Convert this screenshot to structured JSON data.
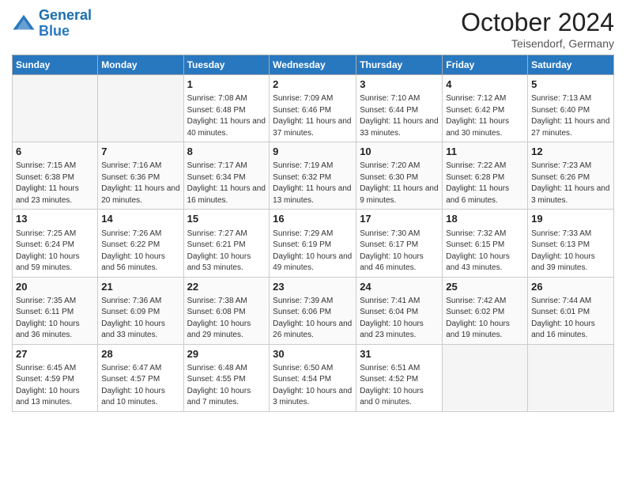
{
  "header": {
    "logo_general": "General",
    "logo_blue": "Blue",
    "month_title": "October 2024",
    "subtitle": "Teisendorf, Germany"
  },
  "days_of_week": [
    "Sunday",
    "Monday",
    "Tuesday",
    "Wednesday",
    "Thursday",
    "Friday",
    "Saturday"
  ],
  "weeks": [
    [
      {
        "day": "",
        "empty": true
      },
      {
        "day": "",
        "empty": true
      },
      {
        "day": "1",
        "sunrise": "Sunrise: 7:08 AM",
        "sunset": "Sunset: 6:48 PM",
        "daylight": "Daylight: 11 hours and 40 minutes."
      },
      {
        "day": "2",
        "sunrise": "Sunrise: 7:09 AM",
        "sunset": "Sunset: 6:46 PM",
        "daylight": "Daylight: 11 hours and 37 minutes."
      },
      {
        "day": "3",
        "sunrise": "Sunrise: 7:10 AM",
        "sunset": "Sunset: 6:44 PM",
        "daylight": "Daylight: 11 hours and 33 minutes."
      },
      {
        "day": "4",
        "sunrise": "Sunrise: 7:12 AM",
        "sunset": "Sunset: 6:42 PM",
        "daylight": "Daylight: 11 hours and 30 minutes."
      },
      {
        "day": "5",
        "sunrise": "Sunrise: 7:13 AM",
        "sunset": "Sunset: 6:40 PM",
        "daylight": "Daylight: 11 hours and 27 minutes."
      }
    ],
    [
      {
        "day": "6",
        "sunrise": "Sunrise: 7:15 AM",
        "sunset": "Sunset: 6:38 PM",
        "daylight": "Daylight: 11 hours and 23 minutes."
      },
      {
        "day": "7",
        "sunrise": "Sunrise: 7:16 AM",
        "sunset": "Sunset: 6:36 PM",
        "daylight": "Daylight: 11 hours and 20 minutes."
      },
      {
        "day": "8",
        "sunrise": "Sunrise: 7:17 AM",
        "sunset": "Sunset: 6:34 PM",
        "daylight": "Daylight: 11 hours and 16 minutes."
      },
      {
        "day": "9",
        "sunrise": "Sunrise: 7:19 AM",
        "sunset": "Sunset: 6:32 PM",
        "daylight": "Daylight: 11 hours and 13 minutes."
      },
      {
        "day": "10",
        "sunrise": "Sunrise: 7:20 AM",
        "sunset": "Sunset: 6:30 PM",
        "daylight": "Daylight: 11 hours and 9 minutes."
      },
      {
        "day": "11",
        "sunrise": "Sunrise: 7:22 AM",
        "sunset": "Sunset: 6:28 PM",
        "daylight": "Daylight: 11 hours and 6 minutes."
      },
      {
        "day": "12",
        "sunrise": "Sunrise: 7:23 AM",
        "sunset": "Sunset: 6:26 PM",
        "daylight": "Daylight: 11 hours and 3 minutes."
      }
    ],
    [
      {
        "day": "13",
        "sunrise": "Sunrise: 7:25 AM",
        "sunset": "Sunset: 6:24 PM",
        "daylight": "Daylight: 10 hours and 59 minutes."
      },
      {
        "day": "14",
        "sunrise": "Sunrise: 7:26 AM",
        "sunset": "Sunset: 6:22 PM",
        "daylight": "Daylight: 10 hours and 56 minutes."
      },
      {
        "day": "15",
        "sunrise": "Sunrise: 7:27 AM",
        "sunset": "Sunset: 6:21 PM",
        "daylight": "Daylight: 10 hours and 53 minutes."
      },
      {
        "day": "16",
        "sunrise": "Sunrise: 7:29 AM",
        "sunset": "Sunset: 6:19 PM",
        "daylight": "Daylight: 10 hours and 49 minutes."
      },
      {
        "day": "17",
        "sunrise": "Sunrise: 7:30 AM",
        "sunset": "Sunset: 6:17 PM",
        "daylight": "Daylight: 10 hours and 46 minutes."
      },
      {
        "day": "18",
        "sunrise": "Sunrise: 7:32 AM",
        "sunset": "Sunset: 6:15 PM",
        "daylight": "Daylight: 10 hours and 43 minutes."
      },
      {
        "day": "19",
        "sunrise": "Sunrise: 7:33 AM",
        "sunset": "Sunset: 6:13 PM",
        "daylight": "Daylight: 10 hours and 39 minutes."
      }
    ],
    [
      {
        "day": "20",
        "sunrise": "Sunrise: 7:35 AM",
        "sunset": "Sunset: 6:11 PM",
        "daylight": "Daylight: 10 hours and 36 minutes."
      },
      {
        "day": "21",
        "sunrise": "Sunrise: 7:36 AM",
        "sunset": "Sunset: 6:09 PM",
        "daylight": "Daylight: 10 hours and 33 minutes."
      },
      {
        "day": "22",
        "sunrise": "Sunrise: 7:38 AM",
        "sunset": "Sunset: 6:08 PM",
        "daylight": "Daylight: 10 hours and 29 minutes."
      },
      {
        "day": "23",
        "sunrise": "Sunrise: 7:39 AM",
        "sunset": "Sunset: 6:06 PM",
        "daylight": "Daylight: 10 hours and 26 minutes."
      },
      {
        "day": "24",
        "sunrise": "Sunrise: 7:41 AM",
        "sunset": "Sunset: 6:04 PM",
        "daylight": "Daylight: 10 hours and 23 minutes."
      },
      {
        "day": "25",
        "sunrise": "Sunrise: 7:42 AM",
        "sunset": "Sunset: 6:02 PM",
        "daylight": "Daylight: 10 hours and 19 minutes."
      },
      {
        "day": "26",
        "sunrise": "Sunrise: 7:44 AM",
        "sunset": "Sunset: 6:01 PM",
        "daylight": "Daylight: 10 hours and 16 minutes."
      }
    ],
    [
      {
        "day": "27",
        "sunrise": "Sunrise: 6:45 AM",
        "sunset": "Sunset: 4:59 PM",
        "daylight": "Daylight: 10 hours and 13 minutes."
      },
      {
        "day": "28",
        "sunrise": "Sunrise: 6:47 AM",
        "sunset": "Sunset: 4:57 PM",
        "daylight": "Daylight: 10 hours and 10 minutes."
      },
      {
        "day": "29",
        "sunrise": "Sunrise: 6:48 AM",
        "sunset": "Sunset: 4:55 PM",
        "daylight": "Daylight: 10 hours and 7 minutes."
      },
      {
        "day": "30",
        "sunrise": "Sunrise: 6:50 AM",
        "sunset": "Sunset: 4:54 PM",
        "daylight": "Daylight: 10 hours and 3 minutes."
      },
      {
        "day": "31",
        "sunrise": "Sunrise: 6:51 AM",
        "sunset": "Sunset: 4:52 PM",
        "daylight": "Daylight: 10 hours and 0 minutes."
      },
      {
        "day": "",
        "empty": true
      },
      {
        "day": "",
        "empty": true
      }
    ]
  ]
}
